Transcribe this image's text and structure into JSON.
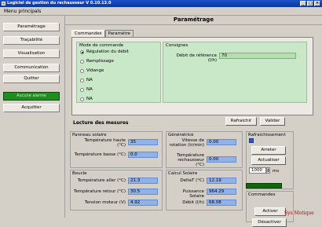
{
  "window": {
    "title": "Logiciel de gestion du rechausseur V 0.10.13.0"
  },
  "menu": {
    "label": "Menu principals"
  },
  "sidebar": {
    "items": [
      {
        "label": "Paramétrage"
      },
      {
        "label": "Traçabilité"
      },
      {
        "label": "Visualisation"
      },
      {
        "label": "Communication"
      },
      {
        "label": "Quitter"
      }
    ],
    "status_label": "Aucune alarme",
    "ack_label": "Acquitter"
  },
  "main": {
    "heading": "Paramétrage",
    "tabs": [
      {
        "label": "Commandes"
      },
      {
        "label": "Paramètre"
      }
    ],
    "mode": {
      "title": "Mode de commande",
      "options": [
        {
          "label": "Régulation du débit",
          "selected": true
        },
        {
          "label": "Remplissage",
          "selected": false
        },
        {
          "label": "Vidange",
          "selected": false
        },
        {
          "label": "NA",
          "selected": false
        },
        {
          "label": "NA",
          "selected": false
        },
        {
          "label": "NA",
          "selected": false
        }
      ]
    },
    "consignes": {
      "title": "Consignes",
      "debit_label": "Débit de référence (l/h)",
      "debit_value": "70"
    },
    "buttons": {
      "refresh": "Rafraichir",
      "validate": "Valider"
    }
  },
  "measures": {
    "title": "Lecture des mesures",
    "panneau": {
      "title": "Panneau solaire",
      "temp_haute_label": "Température haute (°C)",
      "temp_haute_value": "35",
      "temp_basse_label": "Température basse (°C)",
      "temp_basse_value": "0.0"
    },
    "generatrice": {
      "title": "Génératrice",
      "vitesse_label": "Vitesse de rotation (tr/min)",
      "vitesse_value": "0.00",
      "temp_label": "Température rechausseur (°C)",
      "temp_value": "0.00"
    },
    "boucle": {
      "title": "Boucle",
      "aller_label": "Température aller (°C)",
      "aller_value": "21.3",
      "retour_label": "Température retour (°C)",
      "retour_value": "30.5",
      "tension_label": "Tension moteur (V)",
      "tension_value": "4.92"
    },
    "calcul": {
      "title": "Calcul Solaire",
      "delta_label": "DeltaT (°C)",
      "delta_value": "12.19",
      "puissance_label": "Puissance Solaire",
      "puissance_value": "964.29",
      "debit_label": "Débit (l/h)",
      "debit_value": "68.08"
    },
    "rafraichissement": {
      "title": "Rafraichissement",
      "stop": "Arreter",
      "update": "Actualiser",
      "interval_value": "1000",
      "interval_unit": "ms"
    },
    "commandes": {
      "title": "Commandes",
      "activate": "Activer",
      "deactivate": "Désactiver"
    }
  },
  "watermark": "Sys Motique"
}
